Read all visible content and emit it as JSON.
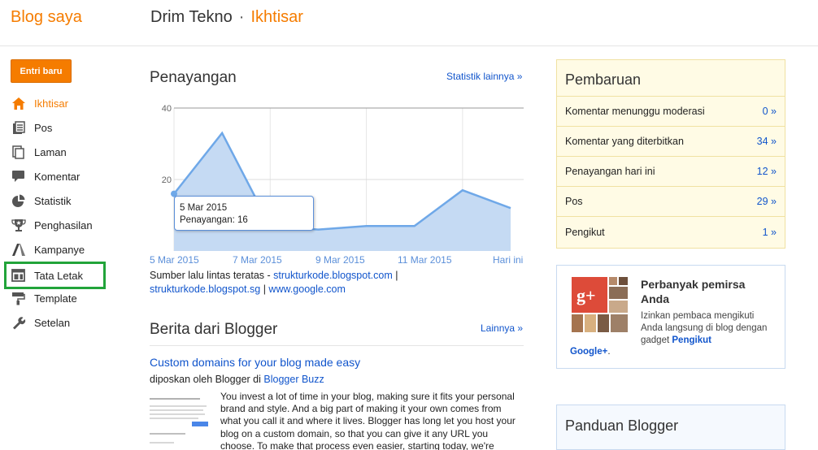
{
  "header": {
    "brand": "Blog saya",
    "blog_name": "Drim Tekno",
    "separator": "·",
    "section": "Ikhtisar"
  },
  "new_post_button": "Entri baru",
  "sidebar": {
    "items": [
      {
        "label": "Ikhtisar",
        "icon": "home-icon"
      },
      {
        "label": "Pos",
        "icon": "posts-icon"
      },
      {
        "label": "Laman",
        "icon": "pages-icon"
      },
      {
        "label": "Komentar",
        "icon": "comments-icon"
      },
      {
        "label": "Statistik",
        "icon": "stats-icon"
      },
      {
        "label": "Penghasilan",
        "icon": "earnings-icon"
      },
      {
        "label": "Kampanye",
        "icon": "campaign-icon"
      },
      {
        "label": "Tata Letak",
        "icon": "layout-icon"
      },
      {
        "label": "Template",
        "icon": "template-icon"
      },
      {
        "label": "Setelan",
        "icon": "settings-icon"
      }
    ]
  },
  "stats": {
    "title": "Penayangan",
    "more_link": "Statistik lainnya »",
    "tooltip_date": "5 Mar 2015",
    "tooltip_value": "Penayangan: 16",
    "sources_prefix": "Sumber lalu lintas teratas -",
    "sources": [
      "strukturkode.blogspot.com",
      "strukturkode.blogspot.sg",
      "www.google.com"
    ],
    "separator": "|"
  },
  "chart_data": {
    "type": "area",
    "x": [
      "5 Mar 2015",
      "6 Mar 2015",
      "7 Mar 2015",
      "8 Mar 2015",
      "9 Mar 2015",
      "10 Mar 2015",
      "11 Mar 2015",
      "12 Mar 2015",
      "Hari ini"
    ],
    "xtick_labels": [
      "5 Mar 2015",
      "7 Mar 2015",
      "9 Mar 2015",
      "11 Mar 2015",
      "Hari ini"
    ],
    "values": [
      16,
      33,
      7,
      6,
      7,
      7,
      17,
      12
    ],
    "yticks": [
      20,
      40
    ],
    "ylim": [
      0,
      40
    ],
    "color": "#6fa8e8",
    "fill": "#c5daf3"
  },
  "news": {
    "title": "Berita dari Blogger",
    "more_link": "Lainnya »",
    "post_title": "Custom domains for your blog made easy",
    "post_meta_prefix": "diposkan oleh Blogger di",
    "post_meta_source": "Blogger Buzz",
    "post_body": "You invest a lot of time in your blog, making sure it fits your personal brand and style. And a big part of making it your own comes from what you call it and where it lives. Blogger has long let you host your blog on a custom domain, so that you can give it any URL you choose. To make that process even easier, starting today, we're"
  },
  "updates": {
    "title": "Pembaruan",
    "rows": [
      {
        "label": "Komentar menunggu moderasi",
        "value": "0 »"
      },
      {
        "label": "Komentar yang diterbitkan",
        "value": "34 »"
      },
      {
        "label": "Penayangan hari ini",
        "value": "12 »"
      },
      {
        "label": "Pos",
        "value": "29 »"
      },
      {
        "label": "Pengikut",
        "value": "1 »"
      }
    ]
  },
  "gplus": {
    "title": "Perbanyak pemirsa Anda",
    "desc": "Izinkan pembaca mengikuti Anda langsung di blog dengan gadget",
    "desc_bold": "Pengikut",
    "link": "Google+",
    "link_suffix": "."
  },
  "guide": {
    "title": "Panduan Blogger"
  },
  "colors": {
    "accent": "#f57c00",
    "link": "#1155cc",
    "highlight": "#22a43a"
  }
}
